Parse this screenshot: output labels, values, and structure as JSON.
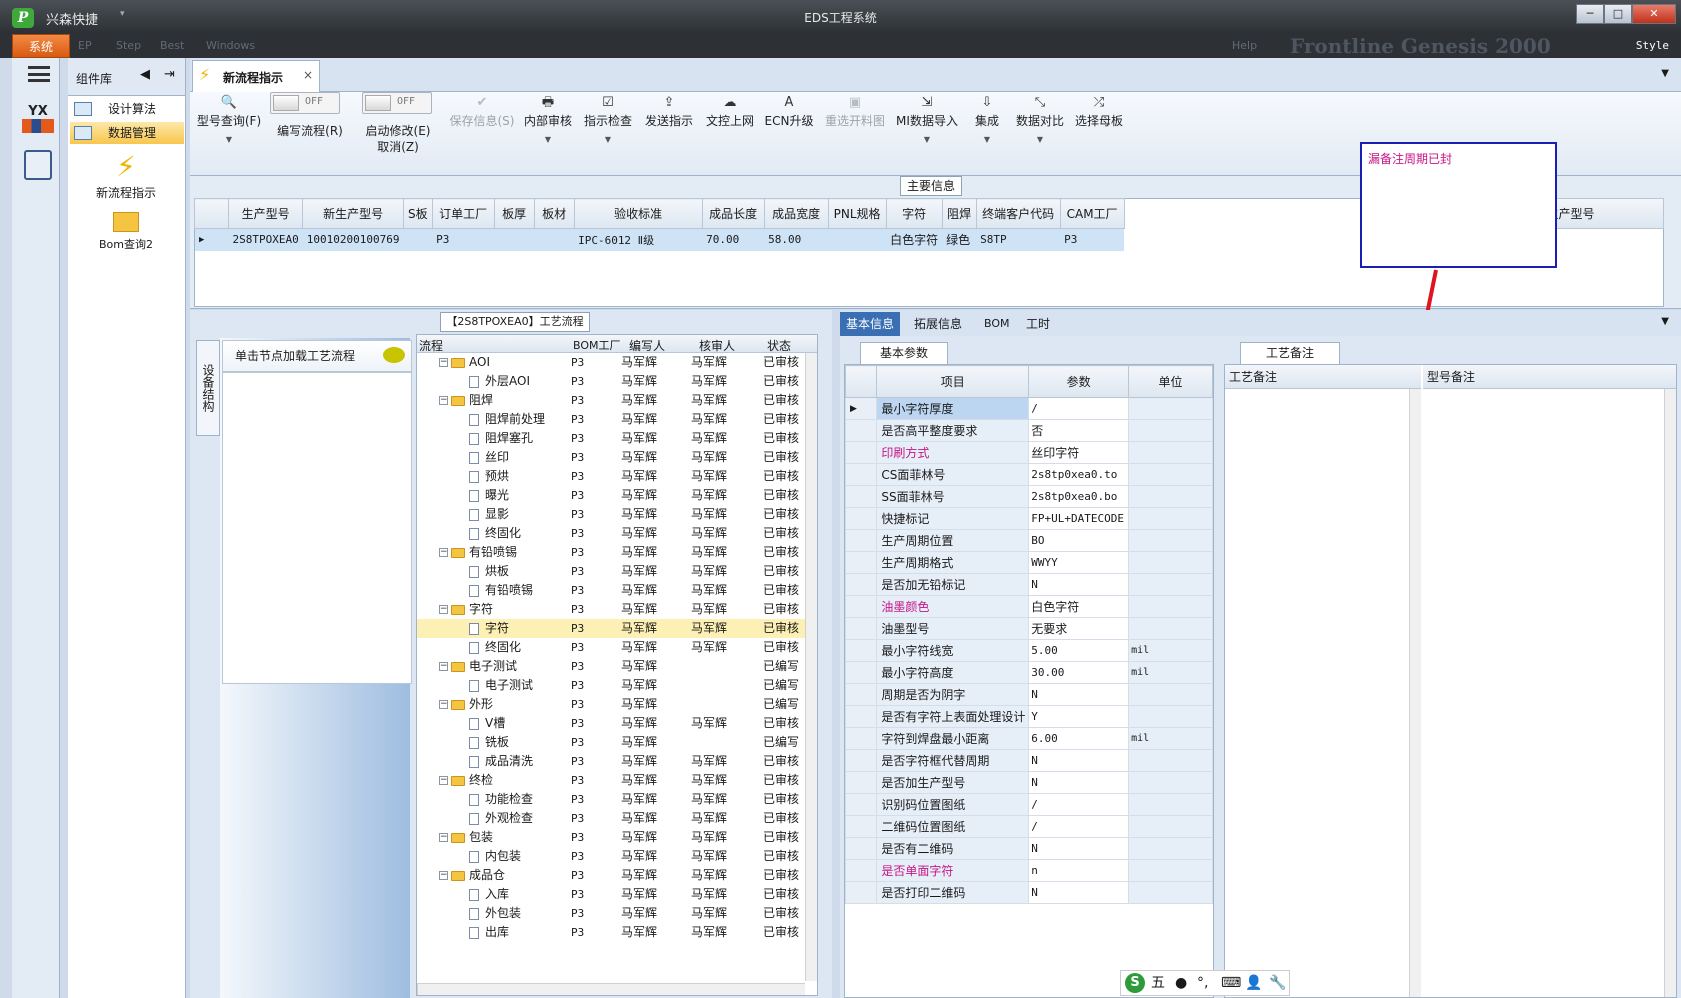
{
  "app": {
    "name": "兴森快捷",
    "window_title": "EDS工程系统",
    "logo": "P",
    "style_label": "Style",
    "banner": "Frontline Genesis 2000"
  },
  "menubar": {
    "system": "系统",
    "dim_items": [
      "EP",
      "Step",
      "Best",
      "Windows"
    ],
    "bar": "Help"
  },
  "component_lib": {
    "title": "组件库",
    "items": [
      {
        "label": "设计算法"
      },
      {
        "label": "数据管理"
      }
    ],
    "big_items": [
      {
        "label": "新流程指示"
      },
      {
        "label": "Bom查询2"
      }
    ]
  },
  "tab": {
    "label": "新流程指示",
    "close": "×"
  },
  "ribbon": {
    "buttons": [
      {
        "label": "型号查询(F)",
        "icon": "search-icon"
      },
      {
        "label": "编写流程(R)",
        "toggle": "OFF"
      },
      {
        "label": "启动修改(E)",
        "label2": "取消(Z)",
        "toggle": "OFF"
      },
      {
        "label": "保存信息(S)",
        "icon": "check-icon"
      },
      {
        "label": "内部审核",
        "icon": "print-icon"
      },
      {
        "label": "指示检查",
        "icon": "checkbox-icon"
      },
      {
        "label": "发送指示",
        "icon": "upload-icon"
      },
      {
        "label": "文控上网",
        "icon": "cloud-icon"
      },
      {
        "label": "ECN升级",
        "icon": "ab-icon"
      },
      {
        "label": "重选开料图",
        "icon": "image-icon"
      },
      {
        "label": "MI数据导入",
        "icon": "import-icon"
      },
      {
        "label": "集成",
        "icon": "download-icon"
      },
      {
        "label": "数据对比",
        "icon": "compare-icon"
      },
      {
        "label": "选择母板",
        "icon": "shuffle-icon"
      }
    ]
  },
  "main_info": {
    "title": "主要信息",
    "columns": [
      "生产型号",
      "新生产型号",
      "S板",
      "订单工厂",
      "板厚",
      "板材",
      "验收标准",
      "成品长度",
      "成品宽度",
      "PNL规格",
      "字符",
      "阻焊",
      "终端客户代码",
      "CAM工厂"
    ],
    "row": [
      "2S8TPOXEA0",
      "10010200100769",
      "",
      "P3",
      "",
      "",
      "IPC-6012 Ⅱ级",
      "70.00",
      "58.00",
      "",
      "白色字符",
      "绿色",
      "S8TP",
      "P3"
    ],
    "right_column": "生产型号"
  },
  "annotation": {
    "text": "漏备注周期已封"
  },
  "flow": {
    "title": "【2S8TPOXEA0】工艺流程",
    "side_tab": "设备结构",
    "hint": "单击节点加载工艺流程",
    "columns": [
      "流程",
      "BOM工厂",
      "编写人",
      "核审人",
      "状态"
    ],
    "rows": [
      {
        "name": "AOI",
        "level": 0,
        "factory": "P3",
        "writer": "马军辉",
        "reviewer": "马军辉",
        "status": "已审核"
      },
      {
        "name": "外层AOI",
        "level": 1,
        "factory": "P3",
        "writer": "马军辉",
        "reviewer": "马军辉",
        "status": "已审核"
      },
      {
        "name": "阻焊",
        "level": 0,
        "factory": "P3",
        "writer": "马军辉",
        "reviewer": "马军辉",
        "status": "已审核"
      },
      {
        "name": "阻焊前处理",
        "level": 1,
        "factory": "P3",
        "writer": "马军辉",
        "reviewer": "马军辉",
        "status": "已审核"
      },
      {
        "name": "阻焊塞孔",
        "level": 1,
        "factory": "P3",
        "writer": "马军辉",
        "reviewer": "马军辉",
        "status": "已审核"
      },
      {
        "name": "丝印",
        "level": 1,
        "factory": "P3",
        "writer": "马军辉",
        "reviewer": "马军辉",
        "status": "已审核"
      },
      {
        "name": "预烘",
        "level": 1,
        "factory": "P3",
        "writer": "马军辉",
        "reviewer": "马军辉",
        "status": "已审核"
      },
      {
        "name": "曝光",
        "level": 1,
        "factory": "P3",
        "writer": "马军辉",
        "reviewer": "马军辉",
        "status": "已审核"
      },
      {
        "name": "显影",
        "level": 1,
        "factory": "P3",
        "writer": "马军辉",
        "reviewer": "马军辉",
        "status": "已审核"
      },
      {
        "name": "终固化",
        "level": 1,
        "factory": "P3",
        "writer": "马军辉",
        "reviewer": "马军辉",
        "status": "已审核"
      },
      {
        "name": "有铅喷锡",
        "level": 0,
        "factory": "P3",
        "writer": "马军辉",
        "reviewer": "马军辉",
        "status": "已审核"
      },
      {
        "name": "烘板",
        "level": 1,
        "factory": "P3",
        "writer": "马军辉",
        "reviewer": "马军辉",
        "status": "已审核"
      },
      {
        "name": "有铅喷锡",
        "level": 1,
        "factory": "P3",
        "writer": "马军辉",
        "reviewer": "马军辉",
        "status": "已审核"
      },
      {
        "name": "字符",
        "level": 0,
        "factory": "P3",
        "writer": "马军辉",
        "reviewer": "马军辉",
        "status": "已审核"
      },
      {
        "name": "字符",
        "level": 1,
        "factory": "P3",
        "writer": "马军辉",
        "reviewer": "马军辉",
        "status": "已审核",
        "selected": true
      },
      {
        "name": "终固化",
        "level": 1,
        "factory": "P3",
        "writer": "马军辉",
        "reviewer": "马军辉",
        "status": "已审核"
      },
      {
        "name": "电子测试",
        "level": 0,
        "factory": "P3",
        "writer": "马军辉",
        "reviewer": "",
        "status": "已编写"
      },
      {
        "name": "电子测试",
        "level": 1,
        "factory": "P3",
        "writer": "马军辉",
        "reviewer": "",
        "status": "已编写"
      },
      {
        "name": "外形",
        "level": 0,
        "factory": "P3",
        "writer": "马军辉",
        "reviewer": "",
        "status": "已编写"
      },
      {
        "name": "V槽",
        "level": 1,
        "factory": "P3",
        "writer": "马军辉",
        "reviewer": "马军辉",
        "status": "已审核"
      },
      {
        "name": "铣板",
        "level": 1,
        "factory": "P3",
        "writer": "马军辉",
        "reviewer": "",
        "status": "已编写"
      },
      {
        "name": "成品清洗",
        "level": 1,
        "factory": "P3",
        "writer": "马军辉",
        "reviewer": "马军辉",
        "status": "已审核"
      },
      {
        "name": "终检",
        "level": 0,
        "factory": "P3",
        "writer": "马军辉",
        "reviewer": "马军辉",
        "status": "已审核"
      },
      {
        "name": "功能检查",
        "level": 1,
        "factory": "P3",
        "writer": "马军辉",
        "reviewer": "马军辉",
        "status": "已审核"
      },
      {
        "name": "外观检查",
        "level": 1,
        "factory": "P3",
        "writer": "马军辉",
        "reviewer": "马军辉",
        "status": "已审核"
      },
      {
        "name": "包装",
        "level": 0,
        "factory": "P3",
        "writer": "马军辉",
        "reviewer": "马军辉",
        "status": "已审核"
      },
      {
        "name": "内包装",
        "level": 1,
        "factory": "P3",
        "writer": "马军辉",
        "reviewer": "马军辉",
        "status": "已审核"
      },
      {
        "name": "成品仓",
        "level": 0,
        "factory": "P3",
        "writer": "马军辉",
        "reviewer": "马军辉",
        "status": "已审核"
      },
      {
        "name": "入库",
        "level": 1,
        "factory": "P3",
        "writer": "马军辉",
        "reviewer": "马军辉",
        "status": "已审核"
      },
      {
        "name": "外包装",
        "level": 1,
        "factory": "P3",
        "writer": "马军辉",
        "reviewer": "马军辉",
        "status": "已审核"
      },
      {
        "name": "出库",
        "level": 1,
        "factory": "P3",
        "writer": "马军辉",
        "reviewer": "马军辉",
        "status": "已审核"
      }
    ]
  },
  "right_tabs": [
    "基本信息",
    "拓展信息",
    "BOM",
    "工时"
  ],
  "basic": {
    "subtab": "基本参数",
    "columns": [
      "项目",
      "参数",
      "单位"
    ],
    "rows": [
      {
        "item": "最小字符厚度",
        "value": "/",
        "unit": "",
        "hl": true
      },
      {
        "item": "是否高平整度要求",
        "value": "否",
        "unit": ""
      },
      {
        "item": "印刷方式",
        "value": "丝印字符",
        "unit": "",
        "pink": true
      },
      {
        "item": "CS面菲林号",
        "value": "2s8tp0xea0.to",
        "unit": ""
      },
      {
        "item": "SS面菲林号",
        "value": "2s8tp0xea0.bo",
        "unit": ""
      },
      {
        "item": "快捷标记",
        "value": "FP+UL+DATECODE",
        "unit": ""
      },
      {
        "item": "生产周期位置",
        "value": "BO",
        "unit": ""
      },
      {
        "item": "生产周期格式",
        "value": "WWYY",
        "unit": ""
      },
      {
        "item": "是否加无铅标记",
        "value": "N",
        "unit": ""
      },
      {
        "item": "油墨颜色",
        "value": "白色字符",
        "unit": "",
        "pink": true
      },
      {
        "item": "油墨型号",
        "value": "无要求",
        "unit": ""
      },
      {
        "item": "最小字符线宽",
        "value": "5.00",
        "unit": "mil"
      },
      {
        "item": "最小字符高度",
        "value": "30.00",
        "unit": "mil"
      },
      {
        "item": "周期是否为阴字",
        "value": "N",
        "unit": ""
      },
      {
        "item": "是否有字符上表面处理设计",
        "value": "Y",
        "unit": ""
      },
      {
        "item": "字符到焊盘最小距离",
        "value": "6.00",
        "unit": "mil"
      },
      {
        "item": "是否字符框代替周期",
        "value": "N",
        "unit": ""
      },
      {
        "item": "是否加生产型号",
        "value": "N",
        "unit": ""
      },
      {
        "item": "识别码位置图纸",
        "value": "/",
        "unit": ""
      },
      {
        "item": "二维码位置图纸",
        "value": "/",
        "unit": ""
      },
      {
        "item": "是否有二维码",
        "value": "N",
        "unit": ""
      },
      {
        "item": "是否单面字符",
        "value": "n",
        "unit": "",
        "pink": true
      },
      {
        "item": "是否打印二维码",
        "value": "N",
        "unit": ""
      }
    ]
  },
  "notes": {
    "subtab": "工艺备注",
    "col1": "工艺备注",
    "col2": "型号备注"
  },
  "ime": {
    "label": "五"
  }
}
